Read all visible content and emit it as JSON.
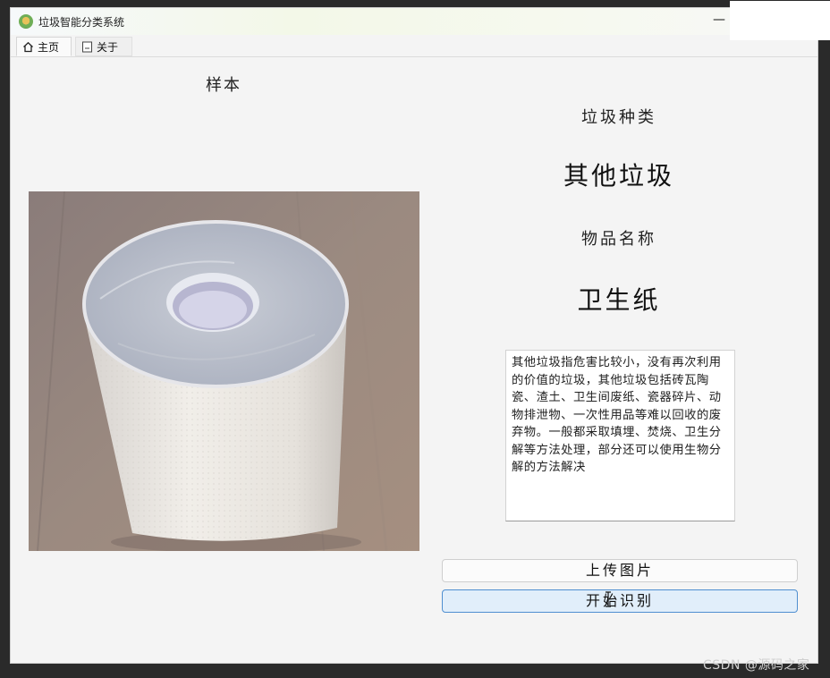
{
  "window": {
    "title": "垃圾智能分类系统",
    "minimize_glyph": "—"
  },
  "tabs": [
    {
      "label": "主页",
      "icon": "home-icon",
      "active": true
    },
    {
      "label": "关于",
      "icon": "document-icon",
      "active": false
    }
  ],
  "main": {
    "sample_label": "样本",
    "category_heading": "垃圾种类",
    "category_value": "其他垃圾",
    "item_heading": "物品名称",
    "item_value": "卫生纸",
    "description": "其他垃圾指危害比较小，没有再次利用的价值的垃圾，其他垃圾包括砖瓦陶瓷、渣土、卫生间废纸、瓷器碎片、动物排泄物、一次性用品等难以回收的废弃物。一般都采取填埋、焚烧、卫生分解等方法处理，部分还可以使用生物分解的方法解决",
    "upload_button": "上传图片",
    "recognize_button": "开始识别"
  },
  "watermark": "CSDN @源码之家",
  "colors": {
    "accent_border": "#4f8fd0",
    "accent_fill": "#e1eefa"
  }
}
